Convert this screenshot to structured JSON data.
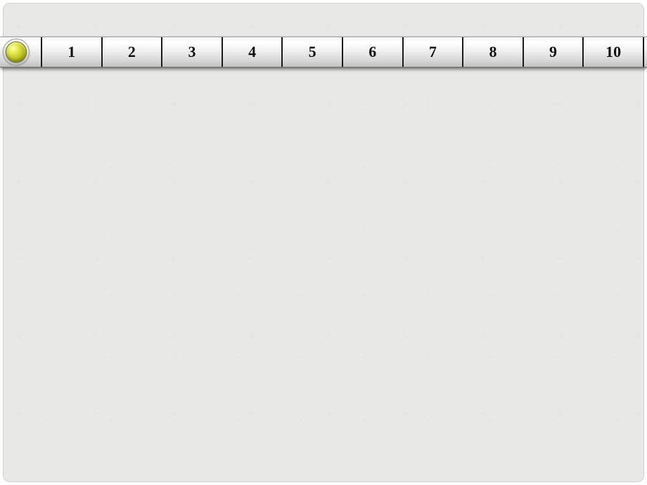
{
  "ruler": {
    "segments": [
      "1",
      "2",
      "3",
      "4",
      "5",
      "6",
      "7",
      "8",
      "9",
      "10"
    ]
  }
}
